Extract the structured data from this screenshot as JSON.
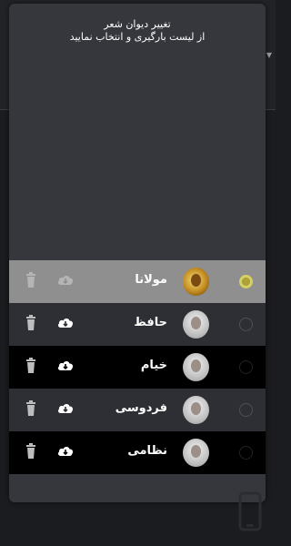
{
  "dialog": {
    "title_line1": "تغییر دیوان شعر",
    "title_line2": "از لیست بارگیری و انتخاب نمایید"
  },
  "poets": [
    {
      "name": "مولانا",
      "selected": true,
      "downloaded": true
    },
    {
      "name": "حافظ",
      "selected": false,
      "downloaded": false
    },
    {
      "name": "خیام",
      "selected": false,
      "downloaded": false
    },
    {
      "name": "فردوسی",
      "selected": false,
      "downloaded": false
    },
    {
      "name": "نظامی",
      "selected": false,
      "downloaded": false
    }
  ],
  "icons": {
    "download": "cloud-download-icon",
    "delete": "trash-icon",
    "radio": "radio-button"
  },
  "colors": {
    "dialog_bg": "#35373d",
    "selected_row": "#8f8f8f",
    "radio_selected": "#d7d05e"
  }
}
